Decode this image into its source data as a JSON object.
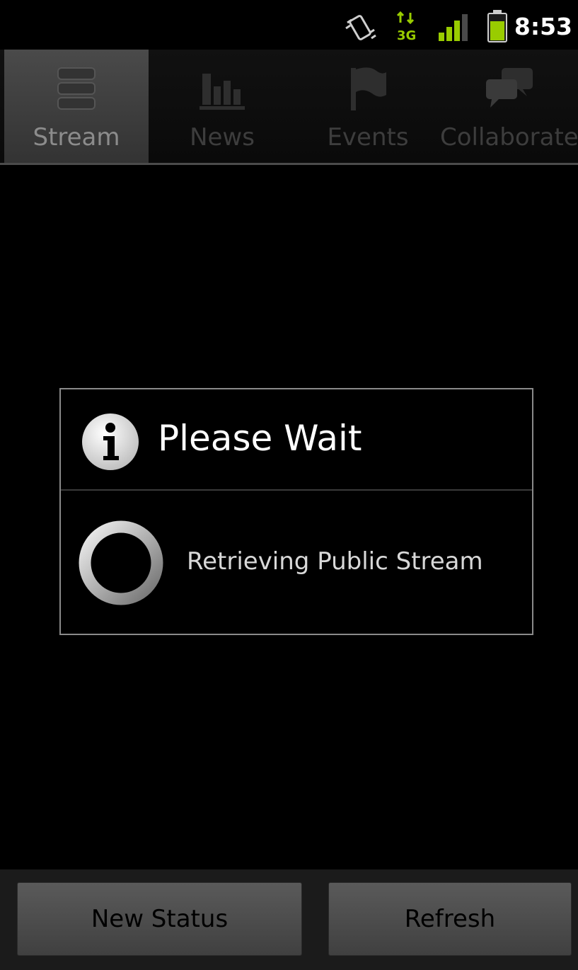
{
  "status_bar": {
    "time": "8:53",
    "network": "3G",
    "icons": [
      "vibrate-icon",
      "3g-data-icon",
      "signal-icon",
      "battery-icon"
    ]
  },
  "tabs": [
    {
      "label": "Stream",
      "icon": "stream-icon",
      "active": true
    },
    {
      "label": "News",
      "icon": "news-icon",
      "active": false
    },
    {
      "label": "Events",
      "icon": "flag-icon",
      "active": false
    },
    {
      "label": "Collaborate",
      "icon": "chat-bubbles-icon",
      "active": false
    }
  ],
  "dialog": {
    "title": "Please Wait",
    "message": "Retrieving Public Stream",
    "icon": "info-icon"
  },
  "bottom_bar": {
    "new_status_label": "New Status",
    "refresh_label": "Refresh"
  },
  "colors": {
    "accent_green": "#99cc00",
    "background": "#000000"
  }
}
